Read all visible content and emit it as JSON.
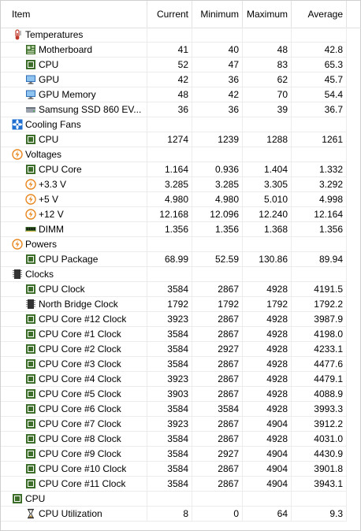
{
  "columns": {
    "item": "Item",
    "current": "Current",
    "minimum": "Minimum",
    "maximum": "Maximum",
    "average": "Average"
  },
  "rows": [
    {
      "group": true,
      "icon": "thermometer-icon",
      "name": "Temperatures",
      "cur": "",
      "min": "",
      "max": "",
      "avg": ""
    },
    {
      "group": false,
      "icon": "motherboard-icon",
      "name": "Motherboard",
      "cur": "41",
      "min": "40",
      "max": "48",
      "avg": "42.8"
    },
    {
      "group": false,
      "icon": "cpu-chip-icon",
      "name": "CPU",
      "cur": "52",
      "min": "47",
      "max": "83",
      "avg": "65.3"
    },
    {
      "group": false,
      "icon": "gpu-monitor-icon",
      "name": "GPU",
      "cur": "42",
      "min": "36",
      "max": "62",
      "avg": "45.7"
    },
    {
      "group": false,
      "icon": "gpu-monitor-icon",
      "name": "GPU Memory",
      "cur": "48",
      "min": "42",
      "max": "70",
      "avg": "54.4"
    },
    {
      "group": false,
      "icon": "ssd-drive-icon",
      "name": "Samsung SSD 860 EV...",
      "cur": "36",
      "min": "36",
      "max": "39",
      "avg": "36.7"
    },
    {
      "group": true,
      "icon": "fan-icon",
      "name": "Cooling Fans",
      "cur": "",
      "min": "",
      "max": "",
      "avg": ""
    },
    {
      "group": false,
      "icon": "cpu-chip-icon",
      "name": "CPU",
      "cur": "1274",
      "min": "1239",
      "max": "1288",
      "avg": "1261"
    },
    {
      "group": true,
      "icon": "lightning-icon",
      "name": "Voltages",
      "cur": "",
      "min": "",
      "max": "",
      "avg": ""
    },
    {
      "group": false,
      "icon": "cpu-chip-icon",
      "name": "CPU Core",
      "cur": "1.164",
      "min": "0.936",
      "max": "1.404",
      "avg": "1.332"
    },
    {
      "group": false,
      "icon": "lightning-icon",
      "name": "+3.3 V",
      "cur": "3.285",
      "min": "3.285",
      "max": "3.305",
      "avg": "3.292"
    },
    {
      "group": false,
      "icon": "lightning-icon",
      "name": "+5 V",
      "cur": "4.980",
      "min": "4.980",
      "max": "5.010",
      "avg": "4.998"
    },
    {
      "group": false,
      "icon": "lightning-icon",
      "name": "+12 V",
      "cur": "12.168",
      "min": "12.096",
      "max": "12.240",
      "avg": "12.164"
    },
    {
      "group": false,
      "icon": "dimm-icon",
      "name": "DIMM",
      "cur": "1.356",
      "min": "1.356",
      "max": "1.368",
      "avg": "1.356"
    },
    {
      "group": true,
      "icon": "lightning-icon",
      "name": "Powers",
      "cur": "",
      "min": "",
      "max": "",
      "avg": ""
    },
    {
      "group": false,
      "icon": "cpu-chip-icon",
      "name": "CPU Package",
      "cur": "68.99",
      "min": "52.59",
      "max": "130.86",
      "avg": "89.94"
    },
    {
      "group": true,
      "icon": "clock-chip-icon",
      "name": "Clocks",
      "cur": "",
      "min": "",
      "max": "",
      "avg": ""
    },
    {
      "group": false,
      "icon": "cpu-chip-icon",
      "name": "CPU Clock",
      "cur": "3584",
      "min": "2867",
      "max": "4928",
      "avg": "4191.5"
    },
    {
      "group": false,
      "icon": "clock-chip-icon",
      "name": "North Bridge Clock",
      "cur": "1792",
      "min": "1792",
      "max": "1792",
      "avg": "1792.2"
    },
    {
      "group": false,
      "icon": "cpu-chip-icon",
      "name": "CPU Core #12 Clock",
      "cur": "3923",
      "min": "2867",
      "max": "4928",
      "avg": "3987.9"
    },
    {
      "group": false,
      "icon": "cpu-chip-icon",
      "name": "CPU Core #1 Clock",
      "cur": "3584",
      "min": "2867",
      "max": "4928",
      "avg": "4198.0"
    },
    {
      "group": false,
      "icon": "cpu-chip-icon",
      "name": "CPU Core #2 Clock",
      "cur": "3584",
      "min": "2927",
      "max": "4928",
      "avg": "4233.1"
    },
    {
      "group": false,
      "icon": "cpu-chip-icon",
      "name": "CPU Core #3 Clock",
      "cur": "3584",
      "min": "2867",
      "max": "4928",
      "avg": "4477.6"
    },
    {
      "group": false,
      "icon": "cpu-chip-icon",
      "name": "CPU Core #4 Clock",
      "cur": "3923",
      "min": "2867",
      "max": "4928",
      "avg": "4479.1"
    },
    {
      "group": false,
      "icon": "cpu-chip-icon",
      "name": "CPU Core #5 Clock",
      "cur": "3903",
      "min": "2867",
      "max": "4928",
      "avg": "4088.9"
    },
    {
      "group": false,
      "icon": "cpu-chip-icon",
      "name": "CPU Core #6 Clock",
      "cur": "3584",
      "min": "3584",
      "max": "4928",
      "avg": "3993.3"
    },
    {
      "group": false,
      "icon": "cpu-chip-icon",
      "name": "CPU Core #7 Clock",
      "cur": "3923",
      "min": "2867",
      "max": "4904",
      "avg": "3912.2"
    },
    {
      "group": false,
      "icon": "cpu-chip-icon",
      "name": "CPU Core #8 Clock",
      "cur": "3584",
      "min": "2867",
      "max": "4928",
      "avg": "4031.0"
    },
    {
      "group": false,
      "icon": "cpu-chip-icon",
      "name": "CPU Core #9 Clock",
      "cur": "3584",
      "min": "2927",
      "max": "4904",
      "avg": "4430.9"
    },
    {
      "group": false,
      "icon": "cpu-chip-icon",
      "name": "CPU Core #10 Clock",
      "cur": "3584",
      "min": "2867",
      "max": "4904",
      "avg": "3901.8"
    },
    {
      "group": false,
      "icon": "cpu-chip-icon",
      "name": "CPU Core #11 Clock",
      "cur": "3584",
      "min": "2867",
      "max": "4904",
      "avg": "3943.1"
    },
    {
      "group": true,
      "icon": "cpu-chip-icon",
      "name": "CPU",
      "cur": "",
      "min": "",
      "max": "",
      "avg": ""
    },
    {
      "group": false,
      "icon": "hourglass-icon",
      "name": "CPU Utilization",
      "cur": "8",
      "min": "0",
      "max": "64",
      "avg": "9.3"
    }
  ],
  "colors": {
    "chip_green": "#3c6e2a",
    "fan_blue": "#1e6fd0",
    "bolt_orange": "#e8871f",
    "thermo_red": "#c0392b",
    "gpu_blue": "#2f6db5"
  }
}
